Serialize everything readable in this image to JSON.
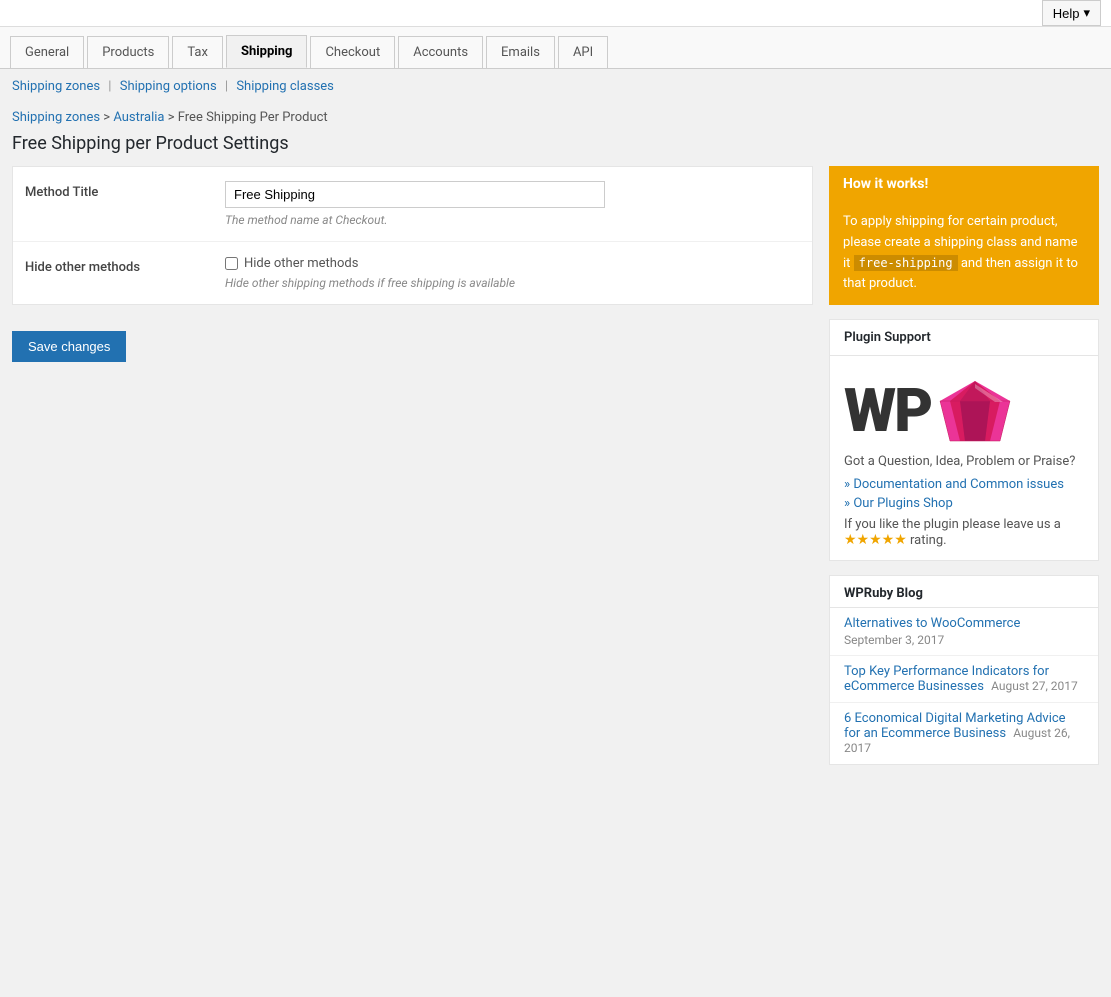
{
  "topbar": {
    "help_label": "Help"
  },
  "nav": {
    "tabs": [
      {
        "id": "general",
        "label": "General",
        "active": false
      },
      {
        "id": "products",
        "label": "Products",
        "active": false
      },
      {
        "id": "tax",
        "label": "Tax",
        "active": false
      },
      {
        "id": "shipping",
        "label": "Shipping",
        "active": true
      },
      {
        "id": "checkout",
        "label": "Checkout",
        "active": false
      },
      {
        "id": "accounts",
        "label": "Accounts",
        "active": false
      },
      {
        "id": "emails",
        "label": "Emails",
        "active": false
      },
      {
        "id": "api",
        "label": "API",
        "active": false
      }
    ]
  },
  "subnav": {
    "items": [
      {
        "label": "Shipping zones",
        "href": "#"
      },
      {
        "label": "Shipping options",
        "href": "#"
      },
      {
        "label": "Shipping classes",
        "href": "#"
      }
    ]
  },
  "breadcrumb": {
    "shipping_zones": "Shipping zones",
    "australia": "Australia",
    "current": "Free Shipping Per Product"
  },
  "page_title": "Free Shipping per Product Settings",
  "form": {
    "method_title_label": "Method Title",
    "method_title_value": "Free Shipping",
    "method_title_hint": "The method name at Checkout.",
    "hide_methods_label": "Hide other methods",
    "hide_methods_checkbox_label": "Hide other methods",
    "hide_methods_hint": "Hide other shipping methods if free shipping is available"
  },
  "save_button": "Save changes",
  "sidebar": {
    "how_it_works": {
      "header": "How it works!",
      "body_text": "To apply shipping for certain product, please create a shipping class and name it",
      "code": "free-shipping",
      "body_text2": "and then assign it to that product."
    },
    "plugin_support": {
      "header": "Plugin Support",
      "support_text": "Got a Question, Idea, Problem or Praise?",
      "links": [
        {
          "label": "Documentation and Common issues",
          "href": "#"
        },
        {
          "label": "Our Plugins Shop",
          "href": "#"
        }
      ],
      "rating_text_before": "If you like the plugin please leave us a",
      "rating_text_after": "rating.",
      "stars": "★★★★★"
    },
    "blog": {
      "header": "WPRuby Blog",
      "posts": [
        {
          "title": "Alternatives to WooCommerce",
          "date": "September 3, 2017",
          "href": "#"
        },
        {
          "title": "Top Key Performance Indicators for eCommerce Businesses",
          "date": "August 27, 2017",
          "href": "#"
        },
        {
          "title": "6 Economical Digital Marketing Advice for an Ecommerce Business",
          "date": "August 26, 2017",
          "href": "#"
        }
      ]
    }
  }
}
